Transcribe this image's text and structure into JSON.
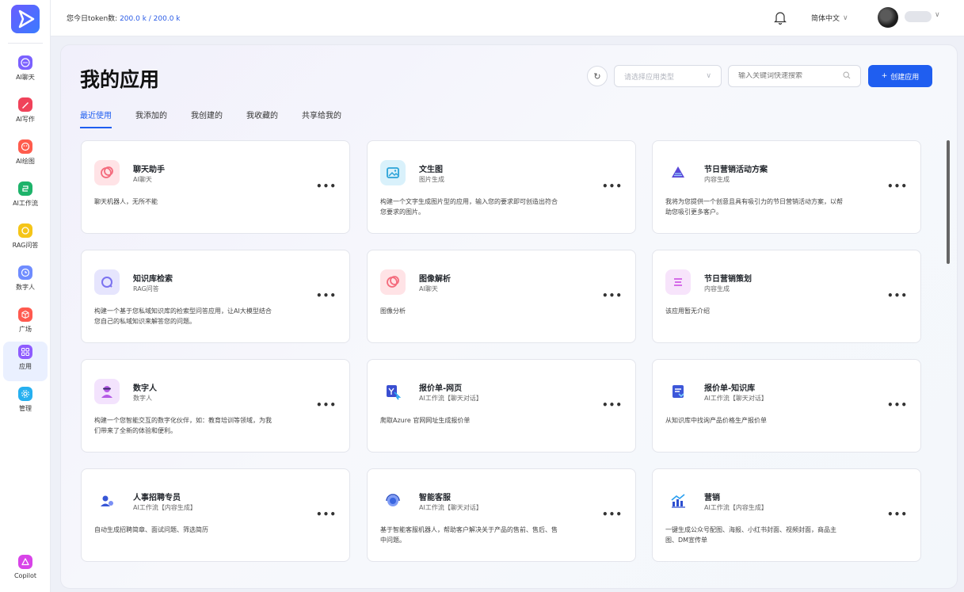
{
  "topbar": {
    "token_label": "您今日token数:",
    "token_value": "200.0 k / 200.0 k",
    "language": "简体中文"
  },
  "sidebar": {
    "items": [
      {
        "label": "AI聊天",
        "color": "#7b61ff",
        "icon": "chat-icon"
      },
      {
        "label": "AI写作",
        "color": "#f0425a",
        "icon": "pen-icon"
      },
      {
        "label": "AI绘图",
        "color": "#ff5c4d",
        "icon": "palette-icon"
      },
      {
        "label": "AI工作流",
        "color": "#1db36a",
        "icon": "workflow-icon"
      },
      {
        "label": "RAG问答",
        "color": "#f5c518",
        "icon": "rag-icon"
      },
      {
        "label": "数字人",
        "color": "#6f8cff",
        "icon": "digital-human-icon"
      },
      {
        "label": "广场",
        "color": "#ff5a4f",
        "icon": "cube-icon"
      },
      {
        "label": "应用",
        "color": "#8e5cff",
        "icon": "apps-icon",
        "active": true
      },
      {
        "label": "管理",
        "color": "#26b0f0",
        "icon": "gear-icon"
      }
    ],
    "copilot_label": "Copilot"
  },
  "page": {
    "title": "我的应用",
    "type_select_placeholder": "请选择应用类型",
    "search_placeholder": "输入关键词快速搜索",
    "create_label": "创建应用",
    "tabs": [
      "最近使用",
      "我添加的",
      "我创建的",
      "我收藏的",
      "共享给我的"
    ],
    "active_tab": "最近使用"
  },
  "cards": [
    {
      "title": "聊天助手",
      "subtitle": "AI聊天",
      "desc": "聊天机器人，无所不能",
      "icon": "chat-bubble-icon",
      "icon_bg": "#ffe3e6",
      "icon_color": "#f46b7d"
    },
    {
      "title": "文生图",
      "subtitle": "图片生成",
      "desc": "构建一个文字生成图片型的应用，输入您的要求即可创造出符合您要求的图片。",
      "icon": "image-icon",
      "icon_bg": "#d9f1fb",
      "icon_color": "#2aa3d8"
    },
    {
      "title": "节日营销活动方案",
      "subtitle": "内容生成",
      "desc": "我将为您提供一个创意且具有吸引力的节日营销活动方案，以帮助您吸引更多客户。",
      "icon": "layers-icon",
      "icon_bg": "#ffffff",
      "icon_color": "#5a48d8"
    },
    {
      "title": "知识库检索",
      "subtitle": "RAG问答",
      "desc": "构建一个基于您私域知识库的检索型问答应用，让AI大模型结合您自己的私域知识来解答您的问题。",
      "icon": "search-icon",
      "icon_bg": "#e6e5fd",
      "icon_color": "#7b72f0"
    },
    {
      "title": "图像解析",
      "subtitle": "AI聊天",
      "desc": "图像分析",
      "icon": "chat-bubble-icon",
      "icon_bg": "#ffe3e6",
      "icon_color": "#f46b7d"
    },
    {
      "title": "节日营销策划",
      "subtitle": "内容生成",
      "desc": "该应用暂无介绍",
      "icon": "document-lines-icon",
      "icon_bg": "#f7e4fb",
      "icon_color": "#d56ce8"
    },
    {
      "title": "数字人",
      "subtitle": "数字人",
      "desc": "构建一个您智能交互的数字化伙伴，如：教育培训等领域，为我们带来了全新的体验和便利。",
      "icon": "person-icon",
      "icon_bg": "#f3e3fd",
      "icon_color": "#b55be6"
    },
    {
      "title": "报价单-网页",
      "subtitle": "AI工作流【聊天对话】",
      "desc": "爬取Azure 官网网址生成报价单",
      "icon": "quote-web-icon",
      "icon_bg": "#ffffff",
      "icon_color": "#3a4fd1"
    },
    {
      "title": "报价单-知识库",
      "subtitle": "AI工作流【聊天对话】",
      "desc": "从知识库中找询产品价格生产报价单",
      "icon": "quote-doc-icon",
      "icon_bg": "#ffffff",
      "icon_color": "#3d57d9"
    },
    {
      "title": "人事招聘专员",
      "subtitle": "AI工作流【内容生成】",
      "desc": "自动生成招聘简章、面试问题、筛选简历",
      "icon": "people-icon",
      "icon_bg": "#ffffff",
      "icon_color": "#3756d6"
    },
    {
      "title": "智能客服",
      "subtitle": "AI工作流【聊天对话】",
      "desc": "基于智能客服机器人，帮助客户解决关于产品的售前、售后、售中问题。",
      "icon": "support-agent-icon",
      "icon_bg": "#ffffff",
      "icon_color": "#3a66e0"
    },
    {
      "title": "营销",
      "subtitle": "AI工作流【内容生成】",
      "desc": "一键生成公众号配图、海报、小红书封面、视频封面，商品主图、DM宣传单",
      "icon": "chart-up-icon",
      "icon_bg": "#ffffff",
      "icon_color": "#2d4fd0"
    }
  ],
  "card_more_label": "•••"
}
